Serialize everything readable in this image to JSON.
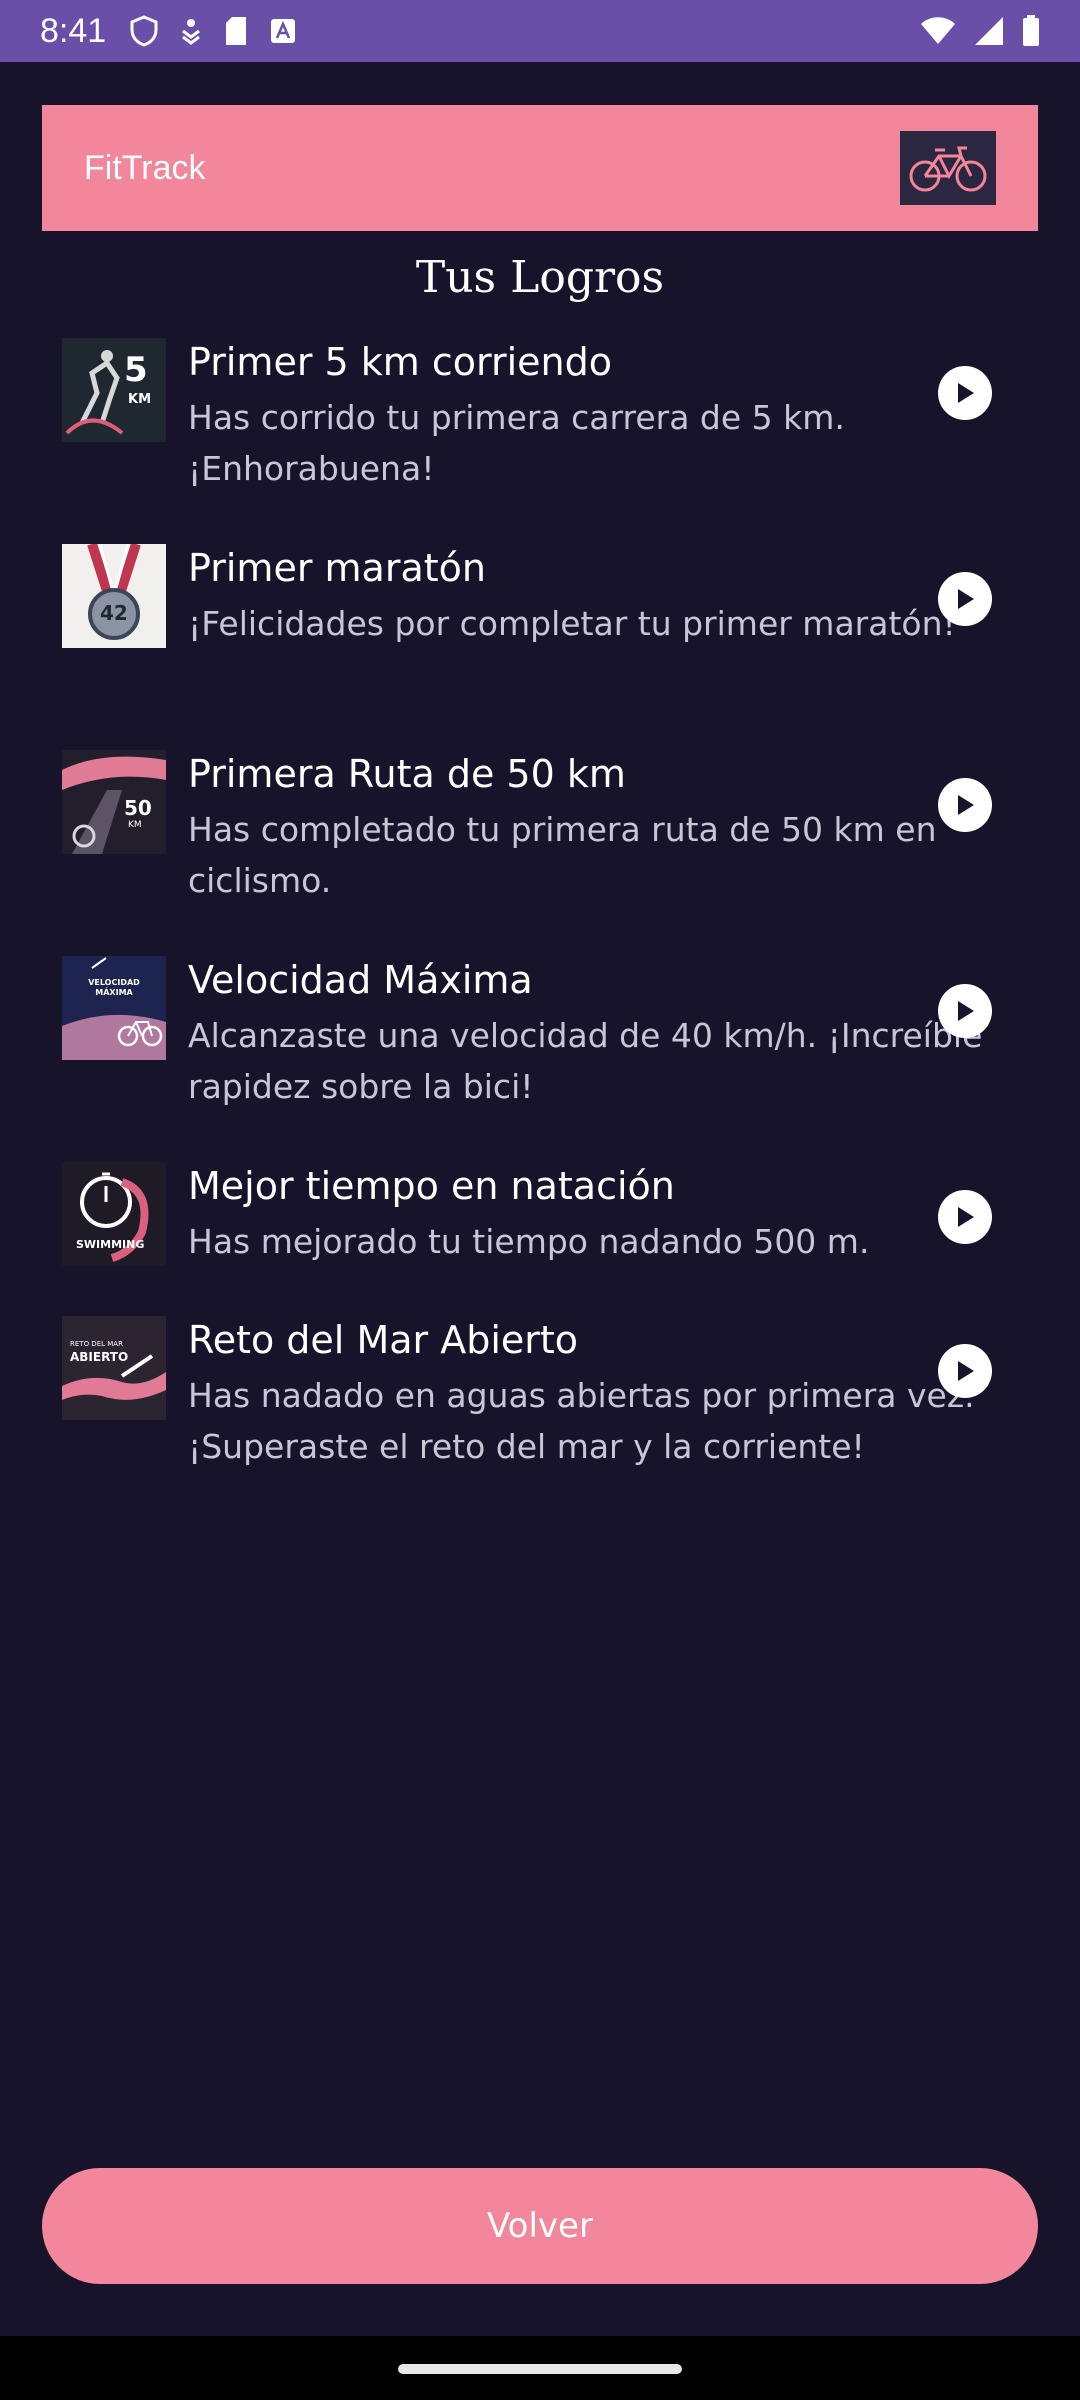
{
  "status_bar": {
    "time": "8:41",
    "icons_left": [
      "shield-icon",
      "signal-stack-icon",
      "sd-card-icon",
      "a-box-icon"
    ],
    "icons_right": [
      "wifi-icon",
      "cell-signal-icon",
      "battery-icon"
    ]
  },
  "app_bar": {
    "title": "FitTrack",
    "logo_icon": "bicycle-logo-icon"
  },
  "page_title": "Tus Logros",
  "achievements": [
    {
      "title": "Primer 5 km corriendo",
      "description": "Has corrido tu primera carrera de 5 km. ¡Enhorabuena!",
      "thumb_text": "5",
      "thumb_subtext": "KM",
      "thumb_icon": "runner-5k-icon"
    },
    {
      "title": "Primer maratón",
      "description": "¡Felicidades por completar tu primer maratón!",
      "thumb_text": "42",
      "thumb_subtext": "",
      "thumb_icon": "medal-icon"
    },
    {
      "title": "Primera Ruta de 50 km",
      "description": "Has completado tu primera ruta de 50 km en ciclismo.",
      "thumb_text": "50",
      "thumb_subtext": "KM",
      "thumb_icon": "cycling-road-icon"
    },
    {
      "title": "Velocidad Máxima",
      "description": "Alcanzaste una velocidad de 40 km/h. ¡Increíble rapidez sobre la bici!",
      "thumb_text": "VELOCIDAD MÁXIMA",
      "thumb_subtext": "",
      "thumb_icon": "speed-bike-icon"
    },
    {
      "title": "Mejor tiempo en natación",
      "description": "Has mejorado tu tiempo nadando 500 m.",
      "thumb_text": "SWIMMING",
      "thumb_subtext": "",
      "thumb_icon": "stopwatch-icon"
    },
    {
      "title": "Reto del Mar Abierto",
      "description": "Has nadado en aguas abiertas por primera vez. ¡Superaste el reto del mar y la corriente!",
      "thumb_text": "ABIERTO",
      "thumb_subtext": "RETO DEL MAR",
      "thumb_icon": "open-water-icon"
    }
  ],
  "back_button": {
    "label": "Volver"
  },
  "colors": {
    "status_bar": "#6a4fa8",
    "background": "#17132b",
    "accent": "#f2869b",
    "description_text": "#c9c4d6"
  }
}
